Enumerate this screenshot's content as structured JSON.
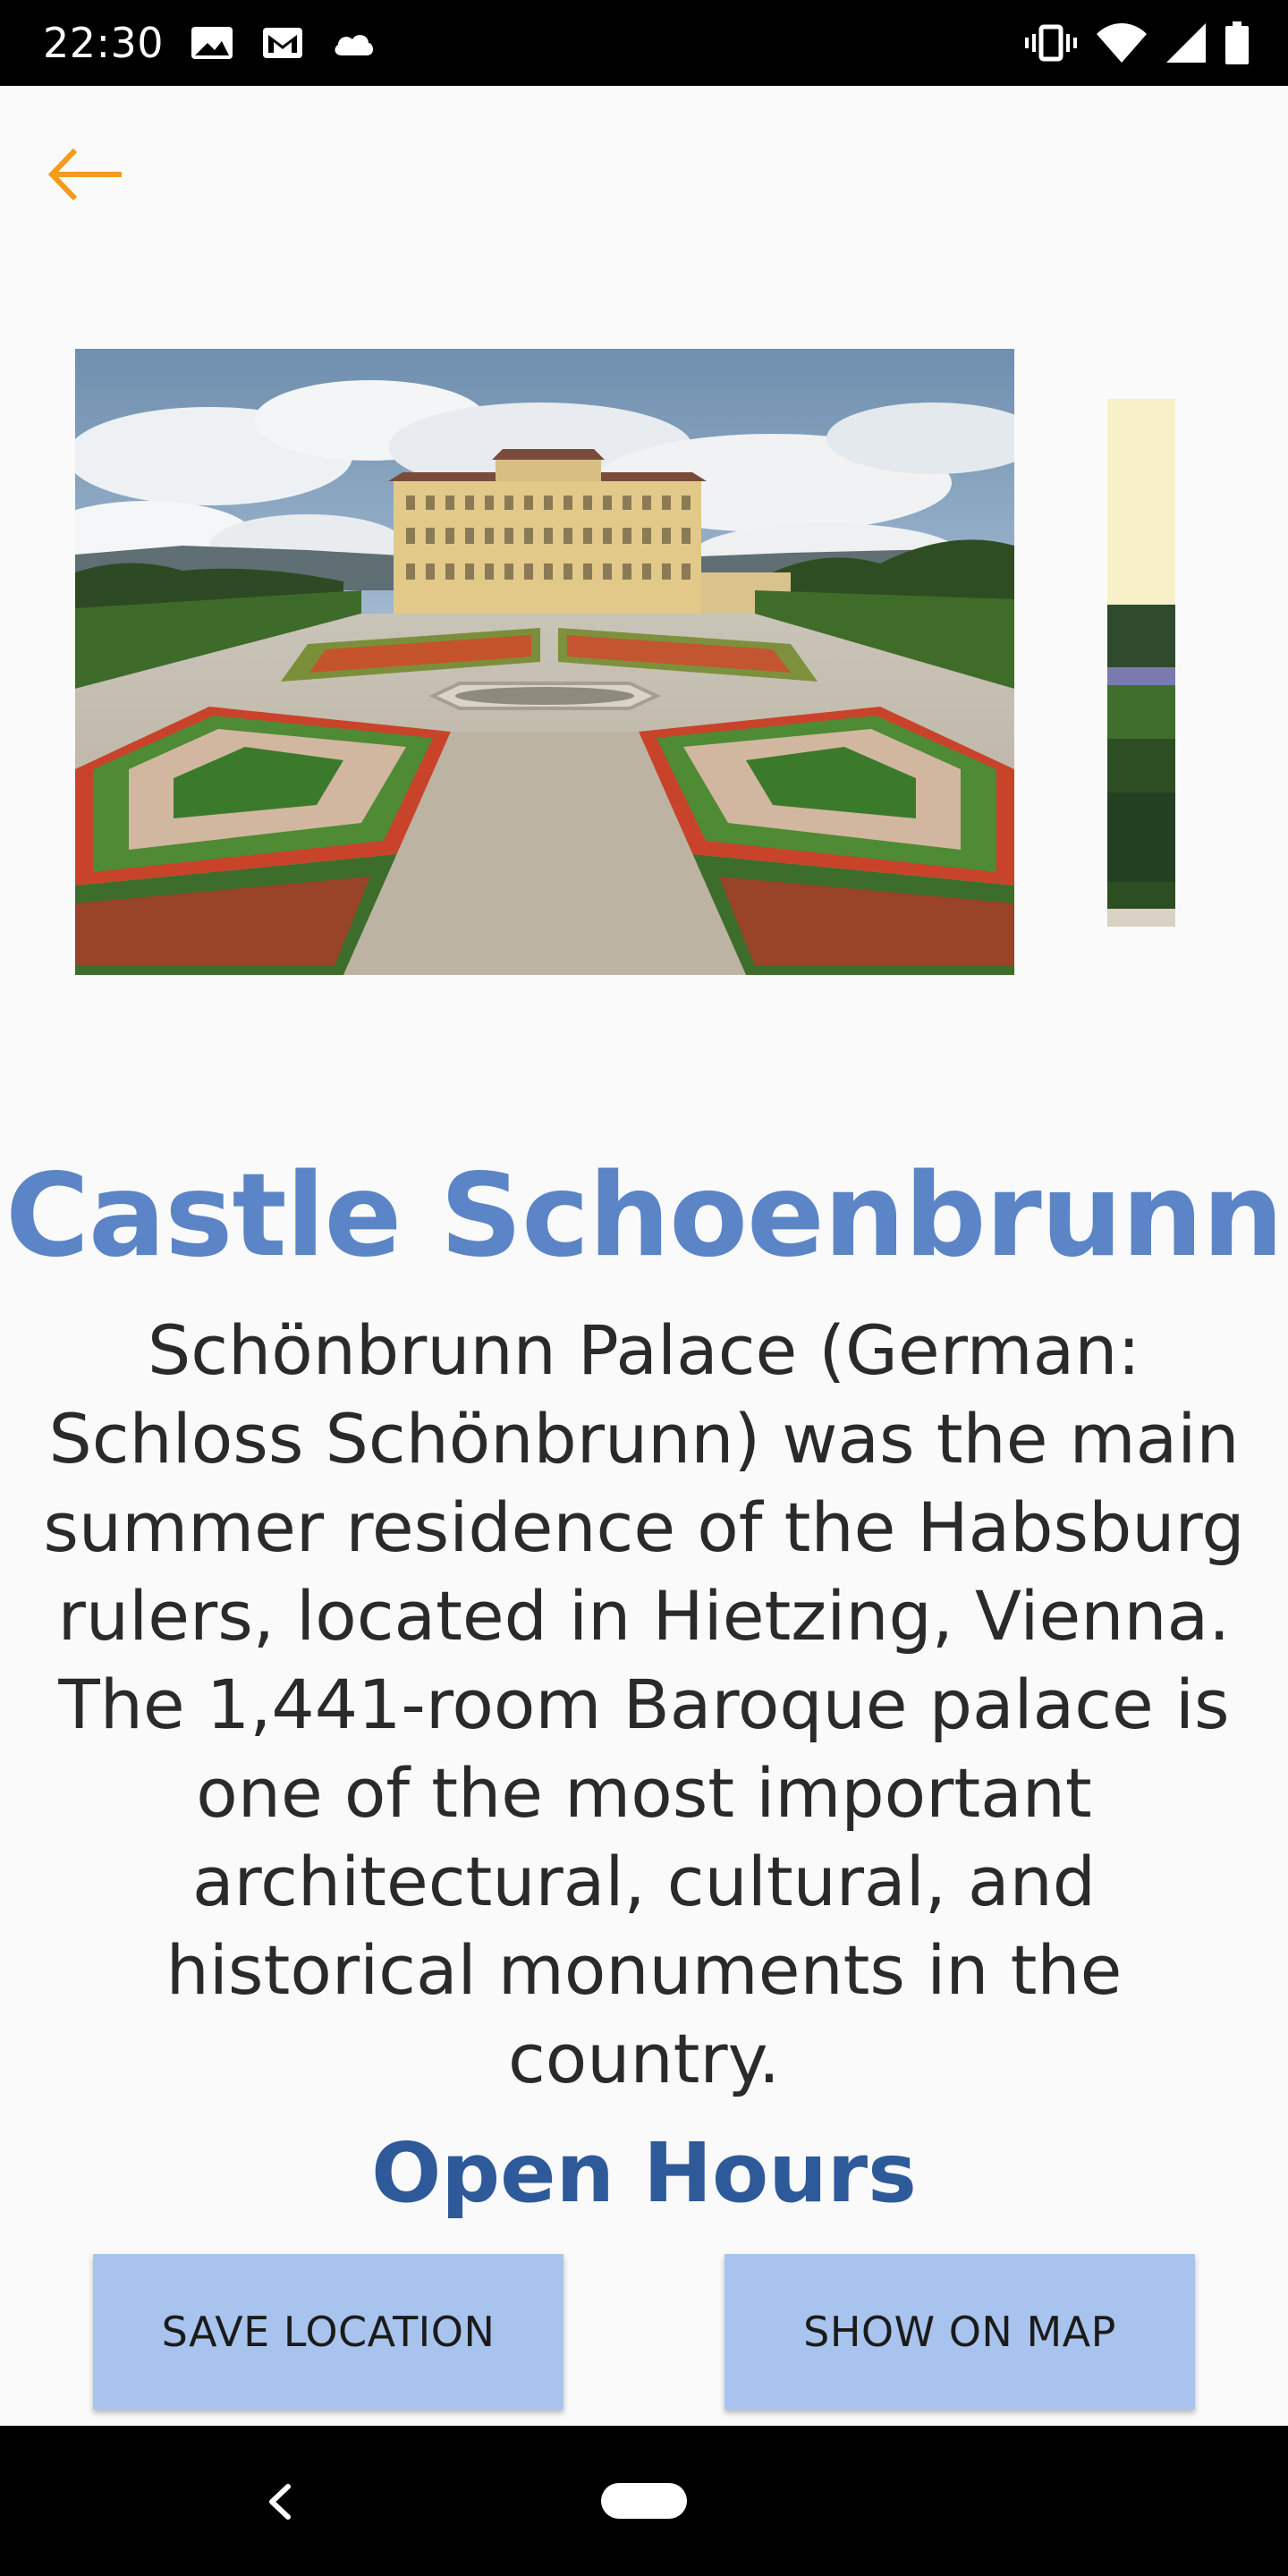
{
  "status_bar": {
    "time": "22:30",
    "left_icons": [
      "image-notification-icon",
      "gmail-icon",
      "cloud-icon"
    ],
    "right_icons": [
      "vibrate-icon",
      "wifi-icon",
      "signal-icon",
      "battery-icon"
    ]
  },
  "toolbar": {
    "back_icon": "arrow-left-icon",
    "accent_color": "#f29b1d"
  },
  "carousel": {
    "images": [
      {
        "subject": "Schönbrunn Palace with formal gardens"
      },
      {
        "subject": "garden and pond"
      }
    ]
  },
  "place": {
    "title": "Castle Schoenbrunn",
    "description": "Schönbrunn Palace (German: Schloss Schönbrunn) was the main summer residence of the Habsburg rulers, located in Hietzing, Vienna. The 1,441-room Baroque palace is one of the most important architectural, cultural, and historical monuments in the country.",
    "section_heading": "Open Hours"
  },
  "actions": {
    "save_label": "SAVE LOCATION",
    "map_label": "SHOW ON MAP"
  },
  "colors": {
    "title": "#5b85c6",
    "heading": "#2e5a9a",
    "button_bg": "#a8c4ee",
    "background": "#fafafa"
  },
  "nav_bar": {
    "icons": [
      "nav-back-icon",
      "home-pill-icon"
    ]
  }
}
